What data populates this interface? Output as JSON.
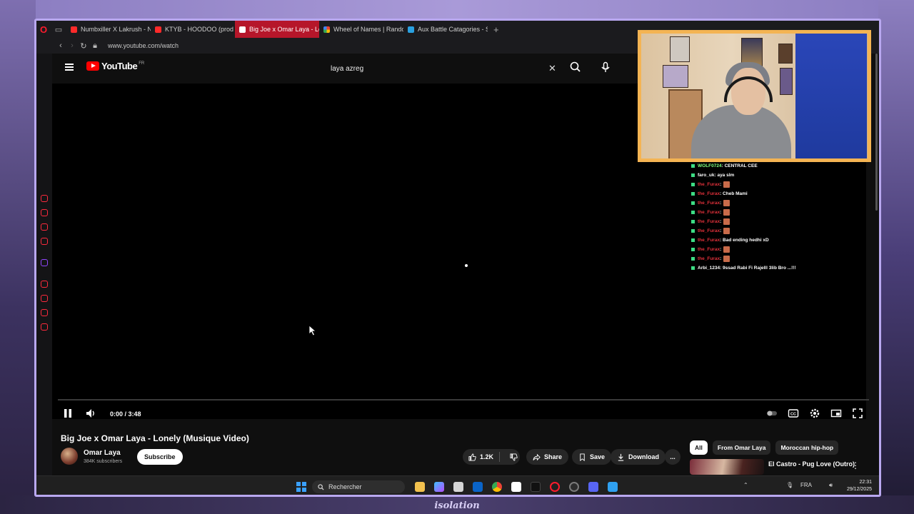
{
  "browser": {
    "tabs": [
      {
        "label": "Numbxiller X Lakrush - Na",
        "color": "#ff2a2a",
        "active": false
      },
      {
        "label": "KTYB - HOODOO (prod by",
        "color": "#ff2a2a",
        "active": false
      },
      {
        "label": "Big Joe x Omar Laya - Lo",
        "color": "#ff2a2a",
        "active": true
      },
      {
        "label": "Wheel of Names | Rando",
        "color": "#34a853",
        "active": false
      },
      {
        "label": "Aux Battle Catagories - Sp",
        "color": "#2aa0e0",
        "active": false
      }
    ],
    "new_tab": "+",
    "url": "www.youtube.com/watch"
  },
  "youtube": {
    "logo_text": "YouTube",
    "region": "FR",
    "search_value": "laya azreg",
    "video": {
      "time": "0:00 / 3:48",
      "title": "Big Joe x Omar Laya - Lonely (Musique Video)"
    },
    "channel": {
      "name": "Omar Laya",
      "subscribers": "384K subscribers",
      "subscribe_label": "Subscribe"
    },
    "actions": {
      "likes": "1.2K",
      "share": "Share",
      "save": "Save",
      "download": "Download",
      "more": "..."
    },
    "chips": [
      "All",
      "From Omar Laya",
      "Moroccan hip-hop"
    ],
    "recommendation": {
      "title": "El Castro - Pug Love (Outro)"
    }
  },
  "chat": [
    {
      "user": "WOLF0724",
      "user_color": "green",
      "msg": ": CENTRAL CEE",
      "emote": false
    },
    {
      "user": "faro_uk",
      "user_color": "white",
      "msg": ": aya slm",
      "emote": false
    },
    {
      "user": "the_Furax",
      "user_color": "red",
      "msg": " :",
      "emote": true
    },
    {
      "user": "the_Furax",
      "user_color": "red",
      "msg": ": Cheb Mami",
      "emote": false
    },
    {
      "user": "the_Furax",
      "user_color": "red",
      "msg": " :",
      "emote": true
    },
    {
      "user": "the_Furax",
      "user_color": "red",
      "msg": " :",
      "emote": true
    },
    {
      "user": "the_Furax",
      "user_color": "red",
      "msg": " :",
      "emote": true
    },
    {
      "user": "the_Furax",
      "user_color": "red",
      "msg": " :",
      "emote": true
    },
    {
      "user": "the_Furax",
      "user_color": "red",
      "msg": ": Bad ending hedhi xD",
      "emote": false
    },
    {
      "user": "the_Furax",
      "user_color": "red",
      "msg": " :",
      "emote": true
    },
    {
      "user": "the_Furax",
      "user_color": "red",
      "msg": " :",
      "emote": true
    },
    {
      "user": "Arbi_1234",
      "user_color": "white",
      "msg": ": 9ssad Rabi Fi Rajelll 3lib Bro ...!!!",
      "emote": false
    }
  ],
  "taskbar": {
    "search_label": "Rechercher",
    "language": "FRA",
    "time": "22:31",
    "date": "29/12/2025"
  },
  "stream_overlay": {
    "brand": "isolation"
  },
  "colors": {
    "accent": "#ff0000",
    "frame": "#b9a8f0",
    "webcam_border": "#f4b453"
  }
}
